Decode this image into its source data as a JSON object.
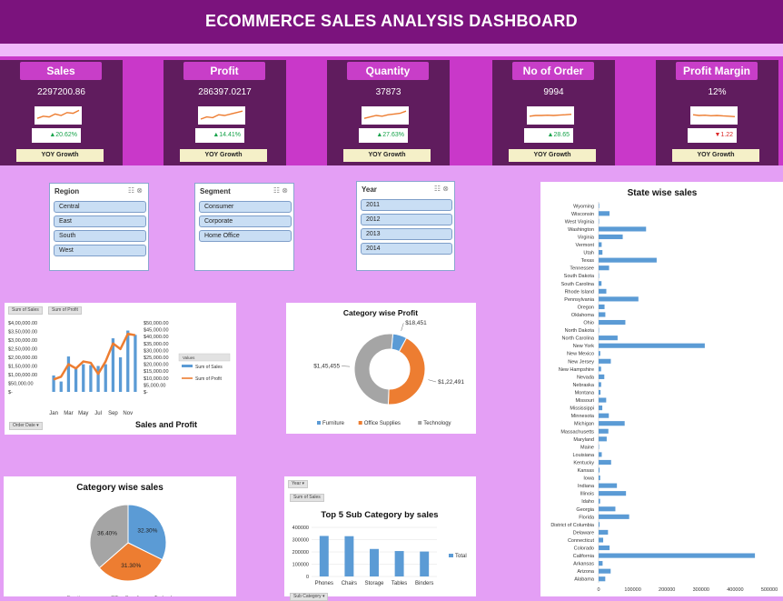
{
  "title": "ECOMMERCE SALES ANALYSIS DASHBOARD",
  "kpis": [
    {
      "title": "Sales",
      "value": "2297200.86",
      "growth": "▲20.62%",
      "growth_color": "#16a34a",
      "spark": [
        0.3,
        0.45,
        0.4,
        0.6,
        0.5,
        0.7,
        0.65,
        0.85
      ],
      "yoy_label": "YOY Growth"
    },
    {
      "title": "Profit",
      "value": "286397.0217",
      "growth": "▲14.41%",
      "growth_color": "#16a34a",
      "spark": [
        0.25,
        0.4,
        0.35,
        0.55,
        0.5,
        0.6,
        0.7,
        0.8
      ],
      "yoy_label": "YOY Growth"
    },
    {
      "title": "Quantity",
      "value": "37873",
      "growth": "▲27.63%",
      "growth_color": "#16a34a",
      "spark": [
        0.3,
        0.4,
        0.5,
        0.45,
        0.55,
        0.6,
        0.65,
        0.8
      ],
      "yoy_label": "YOY Growth"
    },
    {
      "title": "No of Order",
      "value": "9994",
      "growth": "▲28.65",
      "growth_color": "#16a34a",
      "spark": [
        0.45,
        0.5,
        0.5,
        0.52,
        0.5,
        0.53,
        0.55,
        0.58
      ],
      "yoy_label": "YOY Growth"
    },
    {
      "title": "Profit Margin",
      "value": "12%",
      "growth": "▼1.22",
      "growth_color": "#dc2626",
      "spark": [
        0.55,
        0.5,
        0.52,
        0.48,
        0.5,
        0.47,
        0.45,
        0.42
      ],
      "yoy_label": "YOY Growth"
    }
  ],
  "slicers": [
    {
      "header": "Region",
      "items": [
        "Central",
        "East",
        "South",
        "West"
      ]
    },
    {
      "header": "Segment",
      "items": [
        "Consumer",
        "Corporate",
        "Home Office"
      ]
    },
    {
      "header": "Year",
      "items": [
        "2011",
        "2012",
        "2013",
        "2014"
      ]
    }
  ],
  "pivot_buttons": {
    "sum_sales": "Sum of Sales",
    "sum_profit": "Sum of Profit",
    "order_date": "Order Date",
    "year": "Year",
    "sub_category": "Sub Category"
  },
  "colors": {
    "blue": "#5b9bd5",
    "orange": "#ed7d31",
    "gray": "#a5a5a5"
  },
  "chart_data": [
    {
      "type": "bar",
      "title": "Sales and Profit",
      "categories": [
        "Jan",
        "Feb",
        "Mar",
        "Apr",
        "May",
        "Jun",
        "Jul",
        "Aug",
        "Sep",
        "Oct",
        "Nov",
        "Dec"
      ],
      "category_labels": [
        "Jan",
        "",
        "Mar",
        "",
        "May",
        "",
        "Jul",
        "",
        "Sep",
        "",
        "Nov",
        ""
      ],
      "series": [
        {
          "name": "Sum of Sales",
          "type": "bar",
          "axis": "left",
          "values": [
            95000,
            60000,
            205000,
            135000,
            160000,
            155000,
            150000,
            160000,
            310000,
            200000,
            355000,
            330000
          ]
        },
        {
          "name": "Sum of Profit",
          "type": "line",
          "axis": "right",
          "values": [
            9000,
            11000,
            20000,
            17000,
            22000,
            21000,
            13000,
            22000,
            35000,
            31000,
            42000,
            41000
          ]
        }
      ],
      "yticks_left": [
        "$4,00,000.00",
        "$3,50,000.00",
        "$3,00,000.00",
        "$2,50,000.00",
        "$2,00,000.00",
        "$1,50,000.00",
        "$1,00,000.00",
        "$50,000.00",
        "$-"
      ],
      "yticks_right": [
        "$50,000.00",
        "$45,000.00",
        "$40,000.00",
        "$35,000.00",
        "$30,000.00",
        "$25,000.00",
        "$20,000.00",
        "$15,000.00",
        "$10,000.00",
        "$5,000.00",
        "$-"
      ],
      "ylim_left": [
        0,
        400000
      ],
      "ylim_right": [
        0,
        50000
      ],
      "legend_title": "Values",
      "legend": "right"
    },
    {
      "type": "pie",
      "subtype": "donut",
      "title": "Category wise Profit",
      "categories": [
        "Furniture",
        "Office Supplies",
        "Technology"
      ],
      "values": [
        18451,
        122491,
        145455
      ],
      "labels": [
        "$18,451",
        "$1,22,491",
        "$1,45,455"
      ],
      "legend": "bottom"
    },
    {
      "type": "pie",
      "title": "Category wise sales",
      "categories": [
        "Furniture",
        "Office Supplies",
        "Technology"
      ],
      "values": [
        32.3,
        31.3,
        36.4
      ],
      "labels": [
        "32.30%",
        "31.30%",
        "36.40%"
      ]
    },
    {
      "type": "bar",
      "title": "Top 5 Sub Category by sales",
      "categories": [
        "Phones",
        "Chairs",
        "Storage",
        "Tables",
        "Binders"
      ],
      "series": [
        {
          "name": "Total",
          "values": [
            330000,
            328000,
            224000,
            207000,
            203000
          ]
        }
      ],
      "yticks": [
        "400000",
        "300000",
        "200000",
        "100000",
        "0"
      ],
      "ylim": [
        0,
        400000
      ],
      "legend": "right"
    },
    {
      "type": "bar",
      "orientation": "horizontal",
      "title": "State wise sales",
      "categories": [
        "Wyoming",
        "Wisconsin",
        "West Virginia",
        "Washington",
        "Virginia",
        "Vermont",
        "Utah",
        "Texas",
        "Tennessee",
        "South Dakota",
        "South Carolina",
        "Rhode Island",
        "Pennsylvania",
        "Oregon",
        "Oklahoma",
        "Ohio",
        "North Dakota",
        "North Carolina",
        "New York",
        "New Mexico",
        "New Jersey",
        "New Hampshire",
        "Nevada",
        "Nebraska",
        "Montana",
        "Missouri",
        "Mississippi",
        "Minnesota",
        "Michigan",
        "Massachusetts",
        "Maryland",
        "Maine",
        "Louisiana",
        "Kentucky",
        "Kansas",
        "Iowa",
        "Indiana",
        "Illinois",
        "Idaho",
        "Georgia",
        "Florida",
        "District of Columbia",
        "Delaware",
        "Connecticut",
        "Colorado",
        "California",
        "Arkansas",
        "Arizona",
        "Alabama"
      ],
      "values": [
        1600,
        32000,
        1200,
        139000,
        70600,
        8900,
        11200,
        170000,
        30700,
        1300,
        8500,
        22600,
        116500,
        17400,
        19700,
        78300,
        900,
        55600,
        310900,
        4800,
        35800,
        7300,
        16700,
        7500,
        5600,
        22200,
        10800,
        29900,
        76300,
        28600,
        23700,
        1300,
        9200,
        36600,
        2900,
        4600,
        53600,
        80200,
        4400,
        49100,
        89500,
        2900,
        27500,
        13400,
        32100,
        457700,
        11700,
        35300,
        19500
      ],
      "xticks": [
        "0",
        "100000",
        "200000",
        "300000",
        "400000",
        "500000"
      ],
      "xlim": [
        0,
        500000
      ]
    }
  ]
}
